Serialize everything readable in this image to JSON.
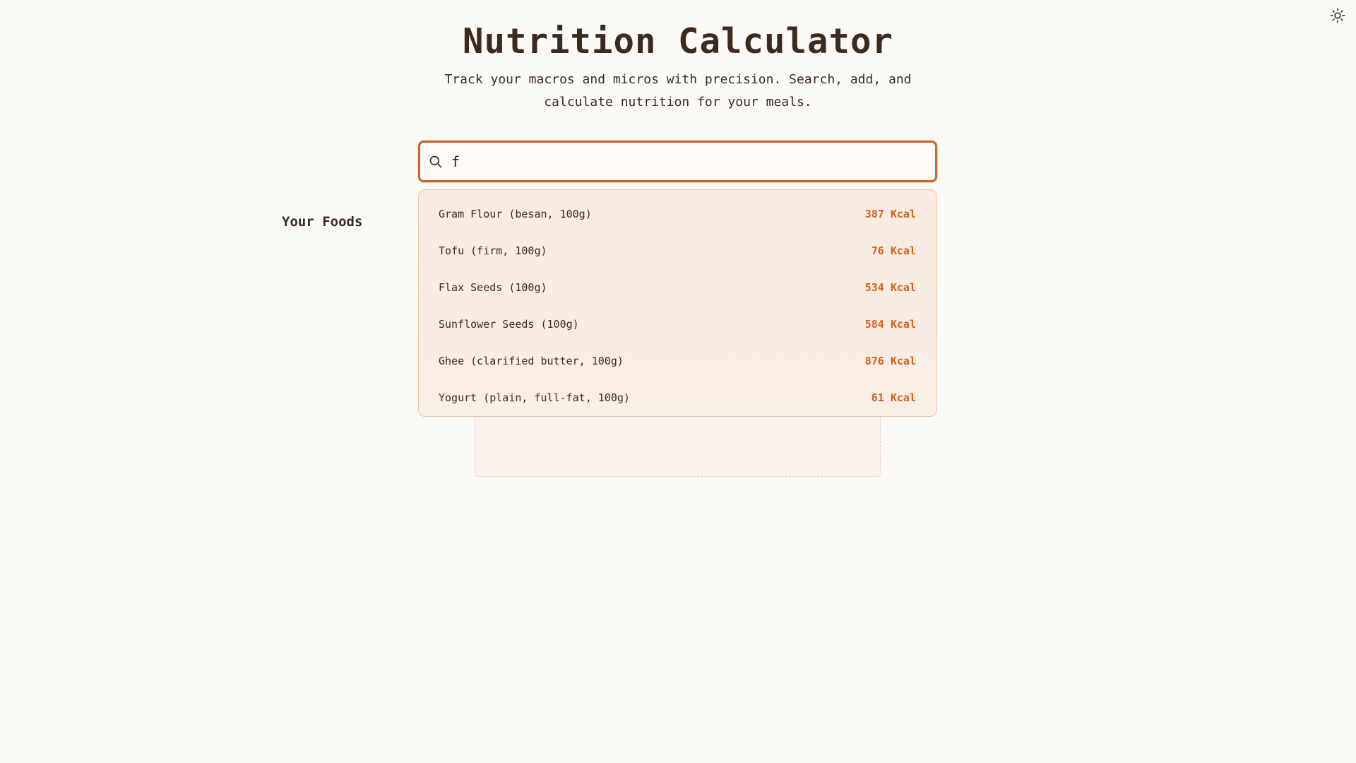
{
  "header": {
    "title": "Nutrition Calculator",
    "subtitle": "Track your macros and micros with precision. Search, add, and calculate nutrition for your meals."
  },
  "theme_toggle": {
    "icon": "sun-icon"
  },
  "search": {
    "icon": "search-icon",
    "value": "f",
    "placeholder": ""
  },
  "foods_section": {
    "label": "Your Foods"
  },
  "dropdown": {
    "items": [
      {
        "name": "Gram Flour (besan, 100g)",
        "kcal": "387 Kcal"
      },
      {
        "name": "Tofu (firm, 100g)",
        "kcal": "76 Kcal"
      },
      {
        "name": "Flax Seeds (100g)",
        "kcal": "534 Kcal"
      },
      {
        "name": "Sunflower Seeds (100g)",
        "kcal": "584 Kcal"
      },
      {
        "name": "Ghee (clarified butter, 100g)",
        "kcal": "876 Kcal"
      },
      {
        "name": "Yogurt (plain, full-fat, 100g)",
        "kcal": "61 Kcal"
      }
    ]
  },
  "colors": {
    "background": "#fcfaf7",
    "accent": "#c6682e",
    "kcal": "#d95f1a",
    "text": "#3b2b22"
  }
}
